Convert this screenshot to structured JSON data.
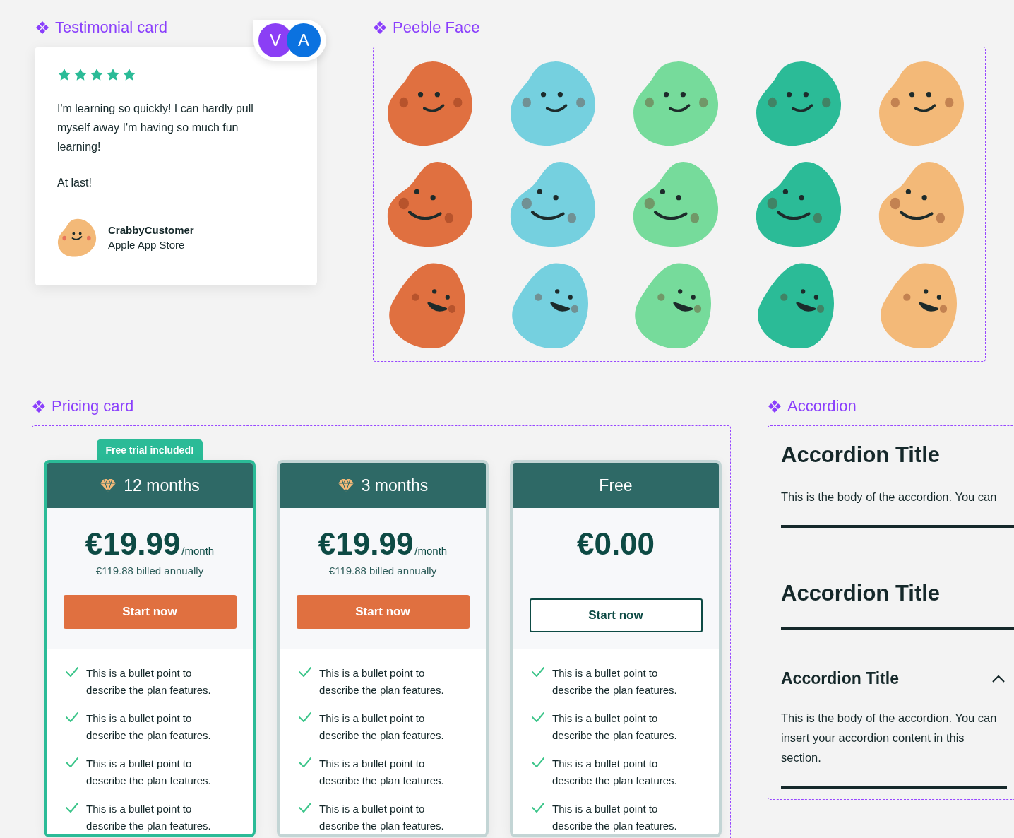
{
  "testimonial": {
    "heading": "Testimonial card",
    "avatars": [
      {
        "initial": "V",
        "color": "#8b3ff5"
      },
      {
        "initial": "A",
        "color": "#0b72e0"
      }
    ],
    "stars": 5,
    "paragraphs": [
      "I'm learning so quickly! I can hardly pull myself away I'm having so much fun learning!",
      "At last!"
    ],
    "author": "CrabbyCustomer",
    "source": "Apple App Store"
  },
  "peeble": {
    "heading": "Peeble Face",
    "rows": [
      {
        "kind": "smile",
        "faces": [
          {
            "color": "#e07040"
          },
          {
            "color": "#75d0df"
          },
          {
            "color": "#76db9b"
          },
          {
            "color": "#2bbb97"
          },
          {
            "color": "#f3b978"
          }
        ]
      },
      {
        "kind": "grin",
        "faces": [
          {
            "color": "#e07040"
          },
          {
            "color": "#75d0df"
          },
          {
            "color": "#76db9b"
          },
          {
            "color": "#2bbb97"
          },
          {
            "color": "#f3b978"
          }
        ]
      },
      {
        "kind": "laugh",
        "faces": [
          {
            "color": "#e07040"
          },
          {
            "color": "#75d0df"
          },
          {
            "color": "#76db9b"
          },
          {
            "color": "#2bbb97"
          },
          {
            "color": "#f3b978"
          }
        ]
      }
    ]
  },
  "pricing": {
    "heading": "Pricing card",
    "plans": [
      {
        "selected": true,
        "badge": "Free trial included!",
        "kind": "paid",
        "title": "12 months",
        "price": "€19.99",
        "period": "/month",
        "billing": "€119.88 billed annually",
        "button": {
          "label": "Start now",
          "kind": "filled"
        },
        "features": [
          "This is a bullet point to describe the plan features.",
          "This is a bullet point to describe the plan features.",
          "This is a bullet point to describe the plan features.",
          "This is a bullet point to describe the plan features."
        ]
      },
      {
        "selected": false,
        "kind": "paid",
        "title": "3 months",
        "price": "€19.99",
        "period": "/month",
        "billing": "€119.88 billed annually",
        "button": {
          "label": "Start now",
          "kind": "filled"
        },
        "features": [
          "This is a bullet point to describe the plan features.",
          "This is a bullet point to describe the plan features.",
          "This is a bullet point to describe the plan features.",
          "This is a bullet point to describe the plan features."
        ]
      },
      {
        "selected": false,
        "kind": "free",
        "title": "Free",
        "price": "€0.00",
        "button": {
          "label": "Start now",
          "kind": "outline"
        },
        "features": [
          "This is a bullet point to describe the plan features.",
          "This is a bullet point to describe the plan features.",
          "This is a bullet point to describe the plan features.",
          "This is a bullet point to describe the plan features."
        ]
      }
    ]
  },
  "accordion": {
    "heading": "Accordion",
    "items": [
      {
        "kind": "large",
        "title": "Accordion Title",
        "body": "This is the body of the accordion. You can"
      },
      {
        "kind": "large",
        "title": "Accordion Title"
      },
      {
        "kind": "compact",
        "expanded": true,
        "title": "Accordion Title",
        "body": "This is the body of the accordion. You can insert your accordion content in this section."
      }
    ]
  }
}
